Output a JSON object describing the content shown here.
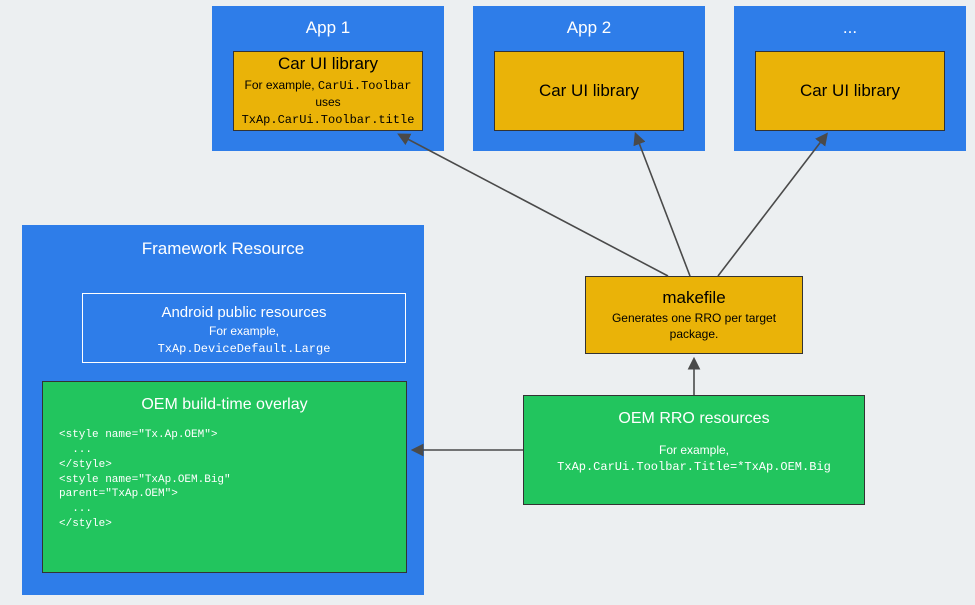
{
  "apps": {
    "app1": {
      "title": "App 1",
      "carui_title": "Car UI library",
      "carui_sub_prefix": "For example, ",
      "carui_sub_code1": "CarUi.Toolbar",
      "carui_sub_mid": " uses",
      "carui_sub_code2": "TxAp.CarUi.Toolbar.title"
    },
    "app2": {
      "title": "App 2",
      "carui_title": "Car UI library"
    },
    "app3": {
      "title": "...",
      "carui_title": "Car UI library"
    }
  },
  "framework": {
    "title": "Framework Resource",
    "pubres": {
      "title": "Android public resources",
      "sub_label": "For example,",
      "sub_code": "TxAp.DeviceDefault.Large"
    },
    "overlay": {
      "title": "OEM build-time overlay",
      "code": "<style name=\"Tx.Ap.OEM\">\n  ...\n</style>\n<style name=\"TxAp.OEM.Big\"\nparent=\"TxAp.OEM\">\n  ...\n</style>"
    }
  },
  "makefile": {
    "title": "makefile",
    "sub": "Generates one RRO per target package."
  },
  "rro": {
    "title": "OEM RRO resources",
    "sub_label": "For example,",
    "sub_code": "TxAp.CarUi.Toolbar.Title=*TxAp.OEM.Big"
  }
}
